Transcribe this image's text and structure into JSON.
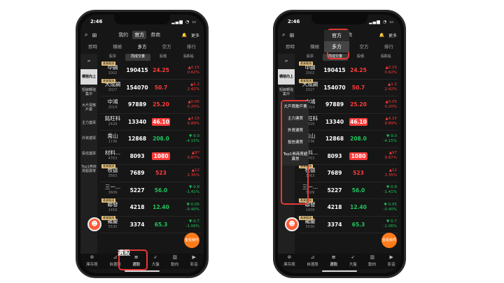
{
  "status": {
    "time": "2:46"
  },
  "header": {
    "modes": [
      "我的",
      "官方",
      "券商"
    ],
    "active_mode": 1,
    "more_label": "更多"
  },
  "subtabs": [
    "即時",
    "積極",
    "多方",
    "空方",
    "排行"
  ],
  "active_subtab": 2,
  "sidebar": {
    "items": [
      "積極向上",
      "短線轉強集中",
      "大戶買散戶賣",
      "主力連買",
      "外資連買",
      "投信連買",
      "Top1券商買超異常"
    ],
    "active": 0
  },
  "columns": [
    "股票",
    "周成交量",
    "股價",
    "漲跌幅"
  ],
  "rows": [
    {
      "tag": "產業龍頭",
      "name": "中鋼",
      "code": "2002",
      "vol": "190415",
      "price": "24.25",
      "color": "red",
      "chg1": "▲0.15",
      "chg2": "0.62%"
    },
    {
      "tag": "產業龍頭",
      "name": "大成鋼",
      "code": "2027",
      "vol": "154070",
      "price": "50.7",
      "color": "red",
      "chg1": "▲1.2",
      "chg2": "2.42%"
    },
    {
      "tag": "",
      "name": "中鴻",
      "code": "2014",
      "vol": "97889",
      "price": "25.20",
      "color": "red",
      "chg1": "▲0.05",
      "chg2": "0.20%"
    },
    {
      "tag": "",
      "name": "銘旺科",
      "code": "2429",
      "vol": "13340",
      "price": "46.10",
      "color": "badge",
      "chg1": "▲4.15",
      "chg2": "9.89%"
    },
    {
      "tag": "",
      "name": "喬山",
      "code": "1736",
      "vol": "12868",
      "price": "208.0",
      "color": "green",
      "chg1": "▼-9.0",
      "chg2": "-4.15%"
    },
    {
      "tag": "",
      "name": "材料...",
      "code": "4763",
      "vol": "8093",
      "price": "1080",
      "color": "badge",
      "chg1": "▲97",
      "chg2": "9.87%"
    },
    {
      "tag": "產業龍頭",
      "name": "牧德",
      "code": "3563",
      "vol": "7689",
      "price": "523",
      "color": "red",
      "chg1": "▲12",
      "chg2": "2.35%"
    },
    {
      "tag": "",
      "name": "三一...",
      "code": "3609",
      "vol": "5227",
      "price": "56.0",
      "color": "green",
      "chg1": "▼-0.8",
      "chg2": "-1.41%"
    },
    {
      "tag": "產業龍頭",
      "name": "聯發",
      "code": "1459",
      "vol": "4218",
      "price": "12.40",
      "color": "green",
      "chg1": "▼-0.05",
      "chg2": "-0.40%"
    },
    {
      "tag": "產業龍頭",
      "name": "羅慶",
      "code": "5530",
      "vol": "3374",
      "price": "65.3",
      "color": "green",
      "chg1": "▼-0.7",
      "chg2": "-1.06%"
    }
  ],
  "bottom_nav": [
    "庫存股",
    "自選股",
    "選股",
    "大盤",
    "動向",
    "影音"
  ],
  "active_nav": 2,
  "orange_btn": "金看條件",
  "popup_highlight_label": "選股"
}
